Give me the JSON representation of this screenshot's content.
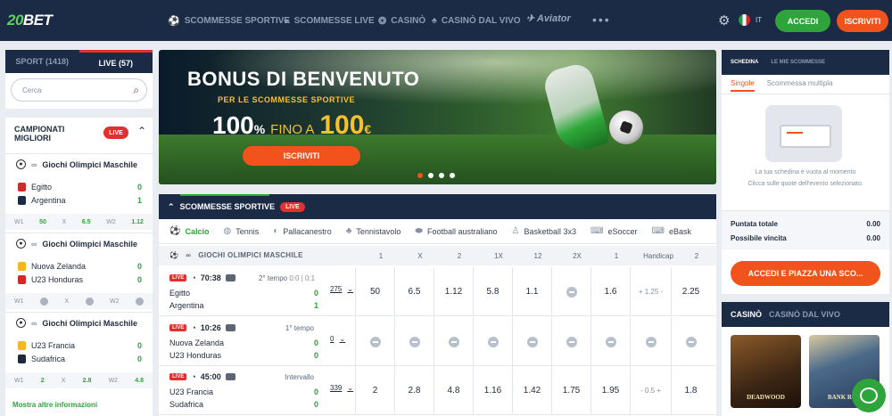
{
  "header": {
    "logo_num": "20",
    "logo_text": "BET",
    "nav": [
      "SCOMMESSE SPORTIVE",
      "SCOMMESSE LIVE",
      "CASINÒ",
      "CASINÒ DAL VIVO"
    ],
    "aviator": "Aviator",
    "more": "•••",
    "lang": "IT",
    "login": "ACCEDI",
    "register": "ISCRIVITI"
  },
  "left": {
    "tab_sport": "SPORT (1418)",
    "tab_live": "LIVE (57)",
    "search_placeholder": "Cerca",
    "section_title": "CAMPIONATI MIGLIORI",
    "live_badge": "LIVE",
    "matches": [
      {
        "league": "Giochi Olimpici Maschile",
        "home": "Egitto",
        "home_score": "0",
        "away": "Argentina",
        "away_score": "1",
        "w1": "50",
        "x": "6.5",
        "w2": "1.12"
      },
      {
        "league": "Giochi Olimpici Maschile",
        "home": "Nuova Zelanda",
        "home_score": "0",
        "away": "U23 Honduras",
        "away_score": "0"
      },
      {
        "league": "Giochi Olimpici Maschile",
        "home": "U23 Francia",
        "home_score": "0",
        "away": "Sudafrica",
        "away_score": "0",
        "w1": "2",
        "x": "2.8",
        "w2": "4.8"
      }
    ],
    "odds_labels": {
      "w1": "W1",
      "x": "X",
      "w2": "W2"
    },
    "more_info": "Mostra altre informazioni"
  },
  "banner": {
    "title": "BONUS DI BENVENUTO",
    "subtitle": "PER LE SCOMMESSE SPORTIVE",
    "pct": "100",
    "pct_sign": "%",
    "fino": "FINO A",
    "amount": "100",
    "currency": "€",
    "cta": "ISCRIVITI"
  },
  "sports": {
    "title": "SCOMMESSE SPORTIVE",
    "live": "LIVE",
    "tabs": [
      "Calcio",
      "Tennis",
      "Pallacanestro",
      "Tennistavolo",
      "Football australiano",
      "Basketball 3x3",
      "eSoccer",
      "eBask"
    ],
    "league": "GIOCHI OLIMPICI MASCHILE",
    "cols": [
      "1",
      "X",
      "2",
      "1X",
      "12",
      "2X",
      "1",
      "Handicap",
      "2"
    ],
    "events": [
      {
        "time": "70:38",
        "period": "2° tempo",
        "ps": "0:0 | 0:1",
        "home": "Egitto",
        "away": "Argentina",
        "hs": "0",
        "as": "1",
        "markets": "275",
        "odds": [
          "50",
          "6.5",
          "1.12",
          "5.8",
          "1.1",
          "",
          "1.6",
          "+ 1.25 -",
          "2.25"
        ]
      },
      {
        "time": "10:26",
        "period": "1° tempo",
        "ps": "",
        "home": "Nuova Zelanda",
        "away": "U23 Honduras",
        "hs": "0",
        "as": "0",
        "markets": "0",
        "odds": [
          "",
          "",
          "",
          "",
          "",
          "",
          "",
          "",
          ""
        ]
      },
      {
        "time": "45:00",
        "period": "Intervallo",
        "ps": "",
        "home": "U23 Francia",
        "away": "Sudafrica",
        "hs": "0",
        "as": "0",
        "markets": "339",
        "odds": [
          "2",
          "2.8",
          "4.8",
          "1.16",
          "1.42",
          "1.75",
          "1.95",
          "- 0.5 +",
          "1.8"
        ]
      }
    ]
  },
  "betslip": {
    "tab1": "SCHEDINA",
    "tab2": "LE MIE SCOMMESSE",
    "single": "Singole",
    "multiple": "Scommessa multipla",
    "empty": "La tua schedina è vuota al momento",
    "hint": "Clicca sulle quote dell'evento selezionato.",
    "total_label": "Puntata totale",
    "total": "0.00",
    "win_label": "Possibile vincita",
    "win": "0.00",
    "cta": "ACCEDI E PIAZZA UNA SCO..."
  },
  "casino": {
    "tab1": "CASINÒ",
    "tab2": "CASINÒ DAL VIVO",
    "games": [
      "DEADWOOD",
      "BANK ROB"
    ]
  }
}
